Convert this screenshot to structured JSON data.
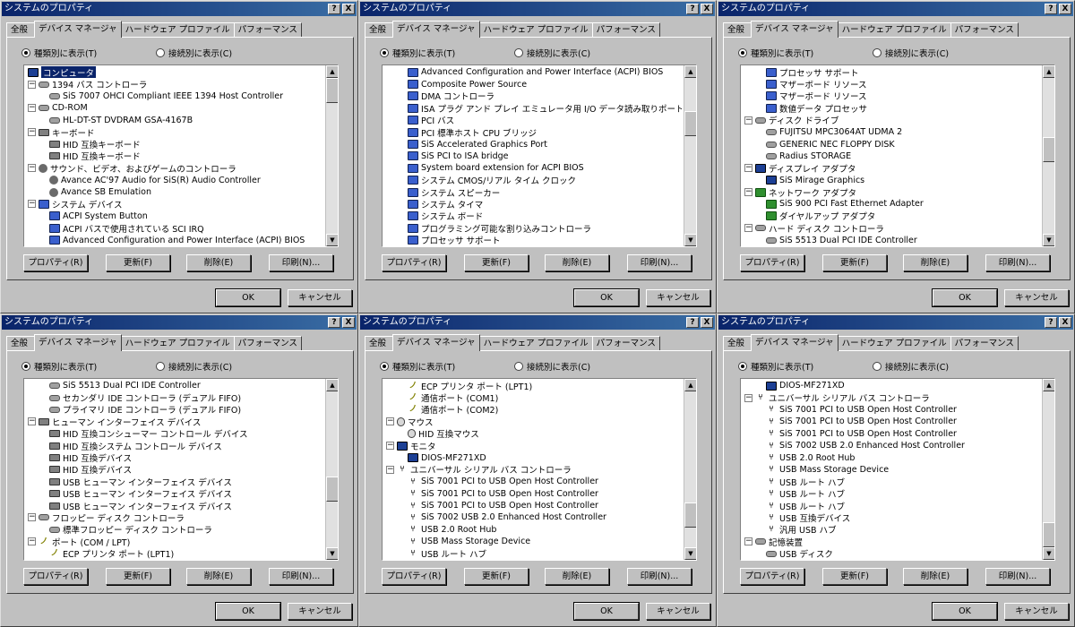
{
  "windows": [
    {
      "title": "システムのプロパティ",
      "help_label": "?",
      "close_label": "X",
      "tabs": [
        "全般",
        "デバイス マネージャ",
        "ハードウェア プロファイル",
        "パフォーマンス"
      ],
      "active_tab": 1,
      "radio_by_type": "種類別に表示(T)",
      "radio_by_connection": "接続別に表示(C)",
      "scroll_position": 0.0,
      "items": [
        {
          "label": "コンピュータ",
          "level": 0,
          "icon": "computer-icon",
          "selected": true
        },
        {
          "label": "1394 バス コントローラ",
          "level": 0,
          "expand": "-",
          "icon": "bus-icon"
        },
        {
          "label": "SiS 7007 OHCI Compliant IEEE 1394 Host Controller",
          "level": 1,
          "icon": "bus-icon"
        },
        {
          "label": "CD-ROM",
          "level": 0,
          "expand": "-",
          "icon": "cdrom-icon"
        },
        {
          "label": "HL-DT-ST DVDRAM GSA-4167B",
          "level": 1,
          "icon": "cdrom-icon"
        },
        {
          "label": "キーボード",
          "level": 0,
          "expand": "-",
          "icon": "keyboard-icon"
        },
        {
          "label": "HID 互換キーボード",
          "level": 1,
          "icon": "keyboard-icon"
        },
        {
          "label": "HID 互換キーボード",
          "level": 1,
          "icon": "keyboard-icon"
        },
        {
          "label": "サウンド、ビデオ、およびゲームのコントローラ",
          "level": 0,
          "expand": "-",
          "icon": "sound-icon"
        },
        {
          "label": "Avance AC'97 Audio for SiS(R) Audio Controller",
          "level": 1,
          "icon": "sound-icon"
        },
        {
          "label": "Avance SB Emulation",
          "level": 1,
          "icon": "sound-icon"
        },
        {
          "label": "システム デバイス",
          "level": 0,
          "expand": "-",
          "icon": "device-icon"
        },
        {
          "label": "ACPI System Button",
          "level": 1,
          "icon": "device-icon"
        },
        {
          "label": "ACPI バスで使用されている SCI IRQ",
          "level": 1,
          "icon": "device-icon"
        },
        {
          "label": "Advanced Configuration and Power Interface (ACPI) BIOS",
          "level": 1,
          "icon": "device-icon"
        }
      ],
      "buttons": {
        "properties": "プロパティ(R)",
        "refresh": "更新(F)",
        "remove": "削除(E)",
        "print": "印刷(N)...",
        "ok": "OK",
        "cancel": "キャンセル"
      }
    },
    {
      "title": "システムのプロパティ",
      "help_label": "?",
      "close_label": "X",
      "tabs": [
        "全般",
        "デバイス マネージャ",
        "ハードウェア プロファイル",
        "パフォーマンス"
      ],
      "active_tab": 1,
      "radio_by_type": "種類別に表示(T)",
      "radio_by_connection": "接続別に表示(C)",
      "scroll_position": 0.25,
      "items": [
        {
          "label": "Advanced Configuration and Power Interface (ACPI) BIOS",
          "level": 1,
          "icon": "device-icon"
        },
        {
          "label": "Composite Power Source",
          "level": 1,
          "icon": "device-icon"
        },
        {
          "label": "DMA コントローラ",
          "level": 1,
          "icon": "device-icon"
        },
        {
          "label": "ISA プラグ アンド プレイ エミュレータ用 I/O データ読み取りポート",
          "level": 1,
          "icon": "device-icon"
        },
        {
          "label": "PCI バス",
          "level": 1,
          "icon": "device-icon"
        },
        {
          "label": "PCI 標準ホスト CPU ブリッジ",
          "level": 1,
          "icon": "device-icon"
        },
        {
          "label": "SiS Accelerated Graphics Port",
          "level": 1,
          "icon": "device-icon"
        },
        {
          "label": "SiS PCI to ISA bridge",
          "level": 1,
          "icon": "device-icon"
        },
        {
          "label": "System board extension for ACPI BIOS",
          "level": 1,
          "icon": "device-icon"
        },
        {
          "label": "システム CMOS/リアル タイム クロック",
          "level": 1,
          "icon": "device-icon"
        },
        {
          "label": "システム スピーカー",
          "level": 1,
          "icon": "device-icon"
        },
        {
          "label": "システム タイマ",
          "level": 1,
          "icon": "device-icon"
        },
        {
          "label": "システム ボード",
          "level": 1,
          "icon": "device-icon"
        },
        {
          "label": "プログラミング可能な割り込みコントローラ",
          "level": 1,
          "icon": "device-icon"
        },
        {
          "label": "プロセッサ サポート",
          "level": 1,
          "icon": "device-icon"
        }
      ],
      "buttons": {
        "properties": "プロパティ(R)",
        "refresh": "更新(F)",
        "remove": "削除(E)",
        "print": "印刷(N)...",
        "ok": "OK",
        "cancel": "キャンセル"
      }
    },
    {
      "title": "システムのプロパティ",
      "help_label": "?",
      "close_label": "X",
      "tabs": [
        "全般",
        "デバイス マネージャ",
        "ハードウェア プロファイル",
        "パフォーマンス"
      ],
      "active_tab": 1,
      "radio_by_type": "種類別に表示(T)",
      "radio_by_connection": "接続別に表示(C)",
      "scroll_position": 0.45,
      "items": [
        {
          "label": "プロセッサ サポート",
          "level": 1,
          "icon": "device-icon"
        },
        {
          "label": "マザーボード リソース",
          "level": 1,
          "icon": "device-icon"
        },
        {
          "label": "マザーボード リソース",
          "level": 1,
          "icon": "device-icon"
        },
        {
          "label": "数値データ プロセッサ",
          "level": 1,
          "icon": "device-icon"
        },
        {
          "label": "ディスク ドライブ",
          "level": 0,
          "expand": "-",
          "icon": "disk-icon"
        },
        {
          "label": "FUJITSU MPC3064AT  UDMA 2",
          "level": 1,
          "icon": "disk-icon"
        },
        {
          "label": "GENERIC NEC  FLOPPY DISK",
          "level": 1,
          "icon": "disk-icon"
        },
        {
          "label": "Radius STORAGE",
          "level": 1,
          "icon": "disk-icon"
        },
        {
          "label": "ディスプレイ アダプタ",
          "level": 0,
          "expand": "-",
          "icon": "monitor-icon"
        },
        {
          "label": "SiS Mirage Graphics",
          "level": 1,
          "icon": "monitor-icon"
        },
        {
          "label": "ネットワーク アダプタ",
          "level": 0,
          "expand": "-",
          "icon": "network-icon"
        },
        {
          "label": "SiS 900 PCI Fast Ethernet Adapter",
          "level": 1,
          "icon": "network-icon"
        },
        {
          "label": "ダイヤルアップ アダプタ",
          "level": 1,
          "icon": "network-icon"
        },
        {
          "label": "ハード ディスク コントローラ",
          "level": 0,
          "expand": "-",
          "icon": "hdc-icon"
        },
        {
          "label": "SiS 5513 Dual PCI IDE Controller",
          "level": 1,
          "icon": "hdc-icon"
        }
      ],
      "buttons": {
        "properties": "プロパティ(R)",
        "refresh": "更新(F)",
        "remove": "削除(E)",
        "print": "印刷(N)...",
        "ok": "OK",
        "cancel": "キャンセル"
      }
    },
    {
      "title": "システムのプロパティ",
      "help_label": "?",
      "close_label": "X",
      "tabs": [
        "全般",
        "デバイス マネージャ",
        "ハードウェア プロファイル",
        "パフォーマンス"
      ],
      "active_tab": 1,
      "radio_by_type": "種類別に表示(T)",
      "radio_by_connection": "接続別に表示(C)",
      "scroll_position": 0.65,
      "items": [
        {
          "label": "SiS 5513 Dual PCI IDE Controller",
          "level": 1,
          "icon": "hdc-icon"
        },
        {
          "label": "セカンダリ IDE コントローラ (デュアル FIFO)",
          "level": 1,
          "icon": "hdc-icon"
        },
        {
          "label": "プライマリ IDE コントローラ (デュアル FIFO)",
          "level": 1,
          "icon": "hdc-icon"
        },
        {
          "label": "ヒューマン インターフェイス デバイス",
          "level": 0,
          "expand": "-",
          "icon": "hid-icon"
        },
        {
          "label": "HID 互換コンシューマー コントロール デバイス",
          "level": 1,
          "icon": "hid-icon"
        },
        {
          "label": "HID 互換システム コントロール デバイス",
          "level": 1,
          "icon": "hid-icon"
        },
        {
          "label": "HID 互換デバイス",
          "level": 1,
          "icon": "hid-icon"
        },
        {
          "label": "HID 互換デバイス",
          "level": 1,
          "icon": "hid-icon"
        },
        {
          "label": "USB ヒューマン インターフェイス デバイス",
          "level": 1,
          "icon": "hid-icon"
        },
        {
          "label": "USB ヒューマン インターフェイス デバイス",
          "level": 1,
          "icon": "hid-icon"
        },
        {
          "label": "USB ヒューマン インターフェイス デバイス",
          "level": 1,
          "icon": "hid-icon"
        },
        {
          "label": "フロッピー ディスク コントローラ",
          "level": 0,
          "expand": "-",
          "icon": "floppy-icon"
        },
        {
          "label": "標準フロッピー ディスク コントローラ",
          "level": 1,
          "icon": "floppy-icon"
        },
        {
          "label": "ポート (COM / LPT)",
          "level": 0,
          "expand": "-",
          "icon": "port-icon"
        },
        {
          "label": "ECP プリンタ ポート (LPT1)",
          "level": 1,
          "icon": "port-icon"
        }
      ],
      "buttons": {
        "properties": "プロパティ(R)",
        "refresh": "更新(F)",
        "remove": "削除(E)",
        "print": "印刷(N)...",
        "ok": "OK",
        "cancel": "キャンセル"
      }
    },
    {
      "title": "システムのプロパティ",
      "help_label": "?",
      "close_label": "X",
      "tabs": [
        "全般",
        "デバイス マネージャ",
        "ハードウェア プロファイル",
        "パフォーマンス"
      ],
      "active_tab": 1,
      "radio_by_type": "種類別に表示(T)",
      "radio_by_connection": "接続別に表示(C)",
      "scroll_position": 0.85,
      "items": [
        {
          "label": "ECP プリンタ ポート (LPT1)",
          "level": 1,
          "icon": "port-icon"
        },
        {
          "label": "通信ポート (COM1)",
          "level": 1,
          "icon": "port-icon"
        },
        {
          "label": "通信ポート (COM2)",
          "level": 1,
          "icon": "port-icon"
        },
        {
          "label": "マウス",
          "level": 0,
          "expand": "-",
          "icon": "mouse-icon"
        },
        {
          "label": "HID 互換マウス",
          "level": 1,
          "icon": "mouse-icon"
        },
        {
          "label": "モニタ",
          "level": 0,
          "expand": "-",
          "icon": "monitor-icon"
        },
        {
          "label": "DIOS-MF271XD",
          "level": 1,
          "icon": "monitor-icon"
        },
        {
          "label": "ユニバーサル シリアル バス コントローラ",
          "level": 0,
          "expand": "-",
          "icon": "usb-icon"
        },
        {
          "label": "SiS 7001 PCI to USB Open Host Controller",
          "level": 1,
          "icon": "usb-icon"
        },
        {
          "label": "SiS 7001 PCI to USB Open Host Controller",
          "level": 1,
          "icon": "usb-icon"
        },
        {
          "label": "SiS 7001 PCI to USB Open Host Controller",
          "level": 1,
          "icon": "usb-icon"
        },
        {
          "label": "SiS 7002 USB 2.0 Enhanced Host Controller",
          "level": 1,
          "icon": "usb-icon"
        },
        {
          "label": "USB 2.0 Root Hub",
          "level": 1,
          "icon": "usb-icon"
        },
        {
          "label": "USB Mass Storage Device",
          "level": 1,
          "icon": "usb-icon"
        },
        {
          "label": "USB ルート ハブ",
          "level": 1,
          "icon": "usb-icon"
        }
      ],
      "buttons": {
        "properties": "プロパティ(R)",
        "refresh": "更新(F)",
        "remove": "削除(E)",
        "print": "印刷(N)...",
        "ok": "OK",
        "cancel": "キャンセル"
      }
    },
    {
      "title": "システムのプロパティ",
      "help_label": "?",
      "close_label": "X",
      "tabs": [
        "全般",
        "デバイス マネージャ",
        "ハードウェア プロファイル",
        "パフォーマンス"
      ],
      "active_tab": 1,
      "radio_by_type": "種類別に表示(T)",
      "radio_by_connection": "接続別に表示(C)",
      "scroll_position": 1.0,
      "items": [
        {
          "label": "DIOS-MF271XD",
          "level": 1,
          "icon": "monitor-icon"
        },
        {
          "label": "ユニバーサル シリアル バス コントローラ",
          "level": 0,
          "expand": "-",
          "icon": "usb-icon"
        },
        {
          "label": "SiS 7001 PCI to USB Open Host Controller",
          "level": 1,
          "icon": "usb-icon"
        },
        {
          "label": "SiS 7001 PCI to USB Open Host Controller",
          "level": 1,
          "icon": "usb-icon"
        },
        {
          "label": "SiS 7001 PCI to USB Open Host Controller",
          "level": 1,
          "icon": "usb-icon"
        },
        {
          "label": "SiS 7002 USB 2.0 Enhanced Host Controller",
          "level": 1,
          "icon": "usb-icon"
        },
        {
          "label": "USB 2.0 Root Hub",
          "level": 1,
          "icon": "usb-icon"
        },
        {
          "label": "USB Mass Storage Device",
          "level": 1,
          "icon": "usb-icon"
        },
        {
          "label": "USB ルート ハブ",
          "level": 1,
          "icon": "usb-icon"
        },
        {
          "label": "USB ルート ハブ",
          "level": 1,
          "icon": "usb-icon"
        },
        {
          "label": "USB ルート ハブ",
          "level": 1,
          "icon": "usb-icon"
        },
        {
          "label": "USB 互換デバイス",
          "level": 1,
          "icon": "usb-icon"
        },
        {
          "label": "汎用 USB ハブ",
          "level": 1,
          "icon": "usb-icon"
        },
        {
          "label": "記憶装置",
          "level": 0,
          "expand": "-",
          "icon": "storage-icon"
        },
        {
          "label": "USB ディスク",
          "level": 1,
          "icon": "storage-icon"
        }
      ],
      "buttons": {
        "properties": "プロパティ(R)",
        "refresh": "更新(F)",
        "remove": "削除(E)",
        "print": "印刷(N)...",
        "ok": "OK",
        "cancel": "キャンセル"
      }
    }
  ]
}
